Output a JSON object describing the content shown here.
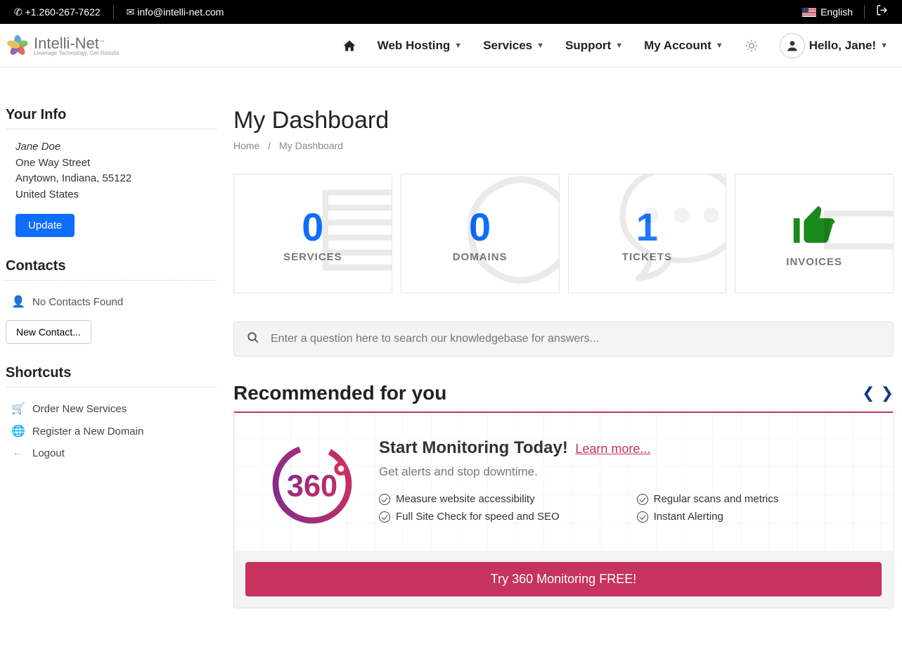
{
  "topbar": {
    "phone": "+1.260-267-7622",
    "email": "info@intelli-net.com",
    "language": "English"
  },
  "brand": {
    "name": "Intelli-Net",
    "tagline": "Leverage Technology, Get Results"
  },
  "nav": {
    "items": [
      "Web Hosting",
      "Services",
      "Support",
      "My Account"
    ],
    "greeting": "Hello, Jane!"
  },
  "sidebar": {
    "your_info_title": "Your Info",
    "name": "Jane Doe",
    "street": "One Way Street",
    "city_line": "Anytown, Indiana, 55122",
    "country": "United States",
    "update_btn": "Update",
    "contacts_title": "Contacts",
    "no_contacts": "No Contacts Found",
    "new_contact_btn": "New Contact...",
    "shortcuts_title": "Shortcuts",
    "shortcuts": [
      "Order New Services",
      "Register a New Domain",
      "Logout"
    ]
  },
  "page": {
    "title": "My Dashboard",
    "breadcrumb_home": "Home",
    "breadcrumb_current": "My Dashboard"
  },
  "stats": {
    "services": {
      "count": "0",
      "label": "SERVICES"
    },
    "domains": {
      "count": "0",
      "label": "DOMAINS"
    },
    "tickets": {
      "count": "1",
      "label": "TICKETS"
    },
    "invoices": {
      "label": "INVOICES"
    }
  },
  "search": {
    "placeholder": "Enter a question here to search our knowledgebase for answers..."
  },
  "recommended": {
    "heading": "Recommended for you",
    "title": "Start Monitoring Today!",
    "learn_more": "Learn more...",
    "subtitle": "Get alerts and stop downtime.",
    "features_left": [
      "Measure website accessibility",
      "Full Site Check for speed and SEO"
    ],
    "features_right": [
      "Regular scans and metrics",
      "Instant Alerting"
    ],
    "cta": "Try 360 Monitoring FREE!"
  }
}
